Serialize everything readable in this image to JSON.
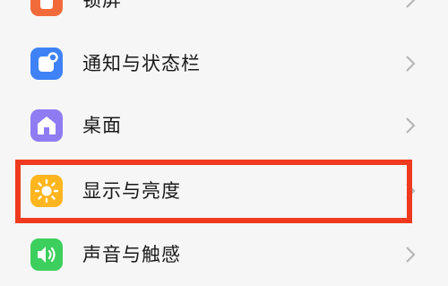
{
  "settings": {
    "items": [
      {
        "label": "锁屏",
        "icon": "lock-screen-icon",
        "color": "#f36a3a"
      },
      {
        "label": "通知与状态栏",
        "icon": "notification-icon",
        "color": "#3f82f6"
      },
      {
        "label": "桌面",
        "icon": "home-icon",
        "color": "#8f7cf3"
      },
      {
        "label": "显示与亮度",
        "icon": "brightness-icon",
        "color": "#ffb51e"
      },
      {
        "label": "声音与触感",
        "icon": "sound-icon",
        "color": "#3ccf5d"
      }
    ]
  },
  "highlight": {
    "color": "#ef3a1f",
    "target": "显示与亮度"
  }
}
